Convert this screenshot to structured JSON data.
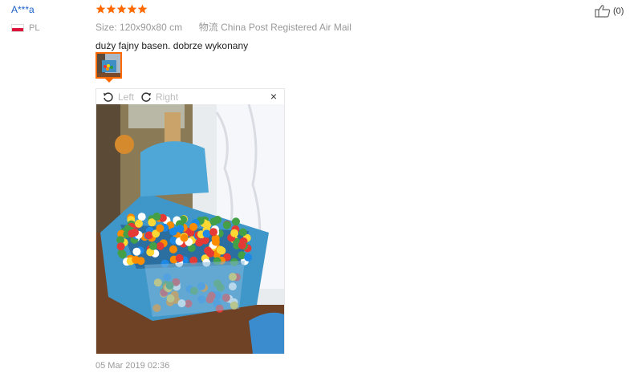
{
  "reviewer": {
    "name": "A***a",
    "country": "PL"
  },
  "review": {
    "rating": 5,
    "size_label": "Size:",
    "size_value": "120x90x80 cm",
    "shipping_label": "物流",
    "shipping_value": "China Post Registered Air Mail",
    "text": "duży fajny basen. dobrze wykonany",
    "date": "05 Mar 2019 02:36"
  },
  "viewer": {
    "rotate_left": "Left",
    "rotate_right": "Right",
    "close": "×"
  },
  "helpful": {
    "count": "(0)"
  },
  "colors": {
    "accent": "#ff6a00",
    "link": "#1d63c9",
    "muted": "#999999"
  }
}
